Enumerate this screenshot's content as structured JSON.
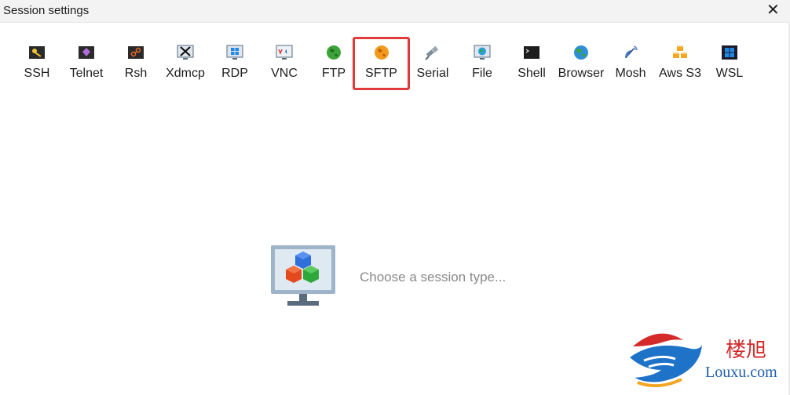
{
  "window": {
    "title": "Session settings",
    "close_symbol": "✕"
  },
  "session_types": [
    {
      "label": "SSH",
      "icon": "ssh-key-icon",
      "selected": false
    },
    {
      "label": "Telnet",
      "icon": "telnet-icon",
      "selected": false
    },
    {
      "label": "Rsh",
      "icon": "rsh-icon",
      "selected": false
    },
    {
      "label": "Xdmcp",
      "icon": "xdmcp-icon",
      "selected": false
    },
    {
      "label": "RDP",
      "icon": "rdp-icon",
      "selected": false
    },
    {
      "label": "VNC",
      "icon": "vnc-icon",
      "selected": false
    },
    {
      "label": "FTP",
      "icon": "ftp-globe-icon",
      "selected": false
    },
    {
      "label": "SFTP",
      "icon": "sftp-globe-icon",
      "selected": true
    },
    {
      "label": "Serial",
      "icon": "serial-plug-icon",
      "selected": false
    },
    {
      "label": "File",
      "icon": "file-monitor-icon",
      "selected": false
    },
    {
      "label": "Shell",
      "icon": "shell-terminal-icon",
      "selected": false
    },
    {
      "label": "Browser",
      "icon": "browser-globe-icon",
      "selected": false
    },
    {
      "label": "Mosh",
      "icon": "mosh-satellite-icon",
      "selected": false
    },
    {
      "label": "Aws S3",
      "icon": "aws-s3-cubes-icon",
      "selected": false
    },
    {
      "label": "WSL",
      "icon": "wsl-windows-icon",
      "selected": false
    }
  ],
  "main": {
    "prompt": "Choose a session type..."
  },
  "watermark": {
    "chinese": "楼旭",
    "site": "Louxu.com"
  },
  "colors": {
    "selection_border": "#e03a3a",
    "prompt_text": "#8a8a8a"
  }
}
